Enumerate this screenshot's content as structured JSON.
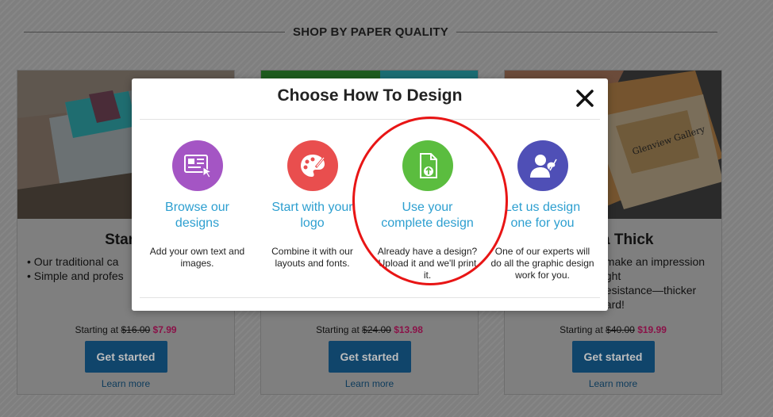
{
  "section": {
    "title": "SHOP BY PAPER QUALITY"
  },
  "cards": [
    {
      "title": "Stand",
      "bullets": [
        "Our traditional ca",
        "Simple and profes"
      ],
      "price_prefix": "Starting at",
      "old_price": "$16.00",
      "new_price": "$7.99",
      "button": "Get started",
      "learn_more": "Learn more"
    },
    {
      "title": "",
      "bullets": [],
      "price_prefix": "Starting at",
      "old_price": "$24.00",
      "new_price": "$13.98",
      "button": "Get started",
      "learn_more": "Learn more"
    },
    {
      "title": "a Thick",
      "bullets": [
        "make an impression",
        "ght",
        "esistance—thicker",
        "ard!"
      ],
      "price_prefix": "Starting at",
      "old_price": "$40.00",
      "new_price": "$19.99",
      "button": "Get started",
      "learn_more": "Learn more",
      "photo_caption": "Glenview Gallery"
    }
  ],
  "modal": {
    "title": "Choose How To Design",
    "close_icon": "close-icon",
    "options": [
      {
        "icon": "browse-designs-icon",
        "color": "#a455c4",
        "title_line1": "Browse our",
        "title_line2": "designs",
        "desc_line1": "Add your own text and",
        "desc_line2": "images."
      },
      {
        "icon": "palette-icon",
        "color": "#e94e4e",
        "title_line1": "Start with your",
        "title_line2": "logo",
        "desc_line1": "Combine it with our",
        "desc_line2": "layouts and fonts."
      },
      {
        "icon": "upload-file-icon",
        "color": "#5bbd3f",
        "title_line1": "Use your",
        "title_line2": "complete design",
        "desc_line1": "Already have a design?",
        "desc_line2": "Upload it and we'll print",
        "desc_line3": "it."
      },
      {
        "icon": "designer-icon",
        "color": "#4f4fb6",
        "title_line1": "Let us design",
        "title_line2": "one for you",
        "desc_line1": "One of our experts will",
        "desc_line2": "do all the graphic design",
        "desc_line3": "work for you."
      }
    ]
  },
  "colors": {
    "accent_link": "#2d9fd0",
    "button": "#1e74b8",
    "sale_price": "#c41a6b",
    "annotation": "#e81515"
  }
}
